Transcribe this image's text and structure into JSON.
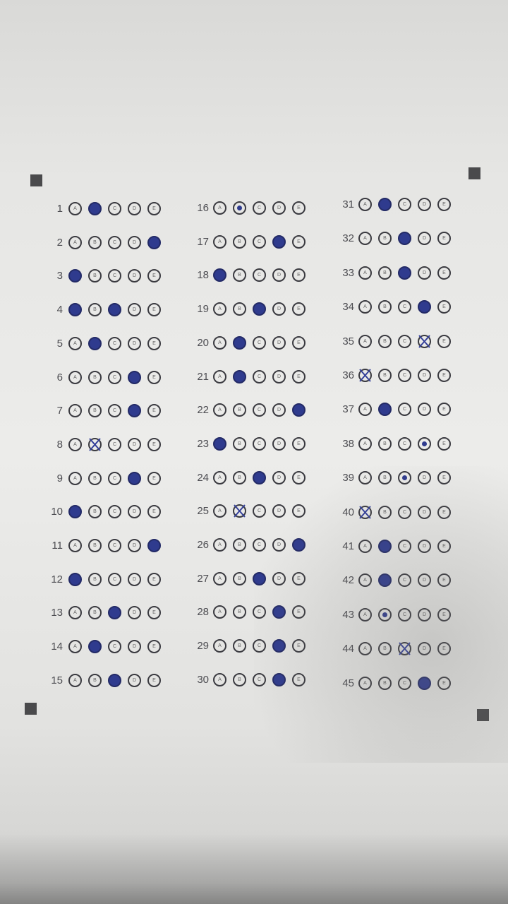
{
  "sheet": {
    "choices": [
      "A",
      "B",
      "C",
      "D",
      "E"
    ],
    "columns": [
      {
        "rows": [
          {
            "number": "1",
            "mark": "B",
            "style": "filled"
          },
          {
            "number": "2",
            "mark": "E",
            "style": "filled"
          },
          {
            "number": "3",
            "mark": "A",
            "style": "filled"
          },
          {
            "number": "4",
            "mark": "A,C",
            "style": "filled"
          },
          {
            "number": "5",
            "mark": "B",
            "style": "filled"
          },
          {
            "number": "6",
            "mark": "D",
            "style": "filled"
          },
          {
            "number": "7",
            "mark": "D",
            "style": "filled"
          },
          {
            "number": "8",
            "mark": "B",
            "style": "crossed"
          },
          {
            "number": "9",
            "mark": "D",
            "style": "filled"
          },
          {
            "number": "10",
            "mark": "A",
            "style": "filled"
          },
          {
            "number": "11",
            "mark": "E",
            "style": "filled"
          },
          {
            "number": "12",
            "mark": "A",
            "style": "filled"
          },
          {
            "number": "13",
            "mark": "C",
            "style": "filled"
          },
          {
            "number": "14",
            "mark": "B",
            "style": "filled"
          },
          {
            "number": "15",
            "mark": "C",
            "style": "filled"
          }
        ]
      },
      {
        "rows": [
          {
            "number": "16",
            "mark": "B",
            "style": "dot"
          },
          {
            "number": "17",
            "mark": "D",
            "style": "filled"
          },
          {
            "number": "18",
            "mark": "A",
            "style": "filled"
          },
          {
            "number": "19",
            "mark": "C",
            "style": "filled"
          },
          {
            "number": "20",
            "mark": "B",
            "style": "filled"
          },
          {
            "number": "21",
            "mark": "B",
            "style": "filled"
          },
          {
            "number": "22",
            "mark": "E",
            "style": "filled"
          },
          {
            "number": "23",
            "mark": "A",
            "style": "filled"
          },
          {
            "number": "24",
            "mark": "C",
            "style": "filled"
          },
          {
            "number": "25",
            "mark": "B",
            "style": "crossed"
          },
          {
            "number": "26",
            "mark": "E",
            "style": "filled"
          },
          {
            "number": "27",
            "mark": "C",
            "style": "filled"
          },
          {
            "number": "28",
            "mark": "D",
            "style": "filled"
          },
          {
            "number": "29",
            "mark": "D",
            "style": "filled"
          },
          {
            "number": "30",
            "mark": "D",
            "style": "filled"
          }
        ]
      },
      {
        "rows": [
          {
            "number": "31",
            "mark": "B",
            "style": "filled"
          },
          {
            "number": "32",
            "mark": "C",
            "style": "filled"
          },
          {
            "number": "33",
            "mark": "C",
            "style": "filled"
          },
          {
            "number": "34",
            "mark": "D",
            "style": "filled"
          },
          {
            "number": "35",
            "mark": "D",
            "style": "crossed"
          },
          {
            "number": "36",
            "mark": "A",
            "style": "crossed"
          },
          {
            "number": "37",
            "mark": "B",
            "style": "filled"
          },
          {
            "number": "38",
            "mark": "D",
            "style": "dot"
          },
          {
            "number": "39",
            "mark": "C",
            "style": "dot"
          },
          {
            "number": "40",
            "mark": "A",
            "style": "crossed"
          },
          {
            "number": "41",
            "mark": "B",
            "style": "filled"
          },
          {
            "number": "42",
            "mark": "B",
            "style": "filled"
          },
          {
            "number": "43",
            "mark": "B",
            "style": "dot"
          },
          {
            "number": "44",
            "mark": "C",
            "style": "crossed"
          },
          {
            "number": "45",
            "mark": "D",
            "style": "filled"
          }
        ]
      }
    ]
  }
}
